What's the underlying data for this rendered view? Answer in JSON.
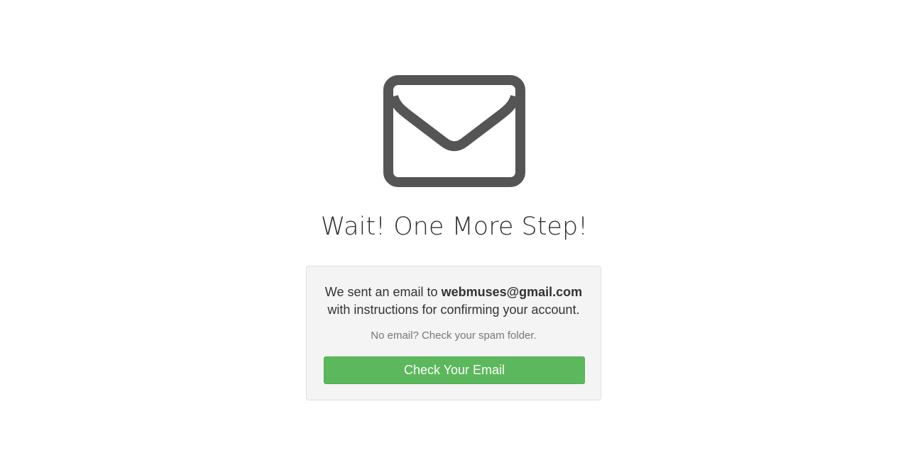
{
  "icon": {
    "name": "envelope-icon",
    "color": "#555555"
  },
  "heading": {
    "title": "Wait! One More Step!"
  },
  "confirmation": {
    "message_prefix": "We sent an email to",
    "email": "webmuses@gmail.com",
    "message_suffix": "with instructions for confirming your account.",
    "hint": "No email? Check your spam folder.",
    "button_label": "Check Your Email",
    "button_color": "#5cb85c"
  }
}
